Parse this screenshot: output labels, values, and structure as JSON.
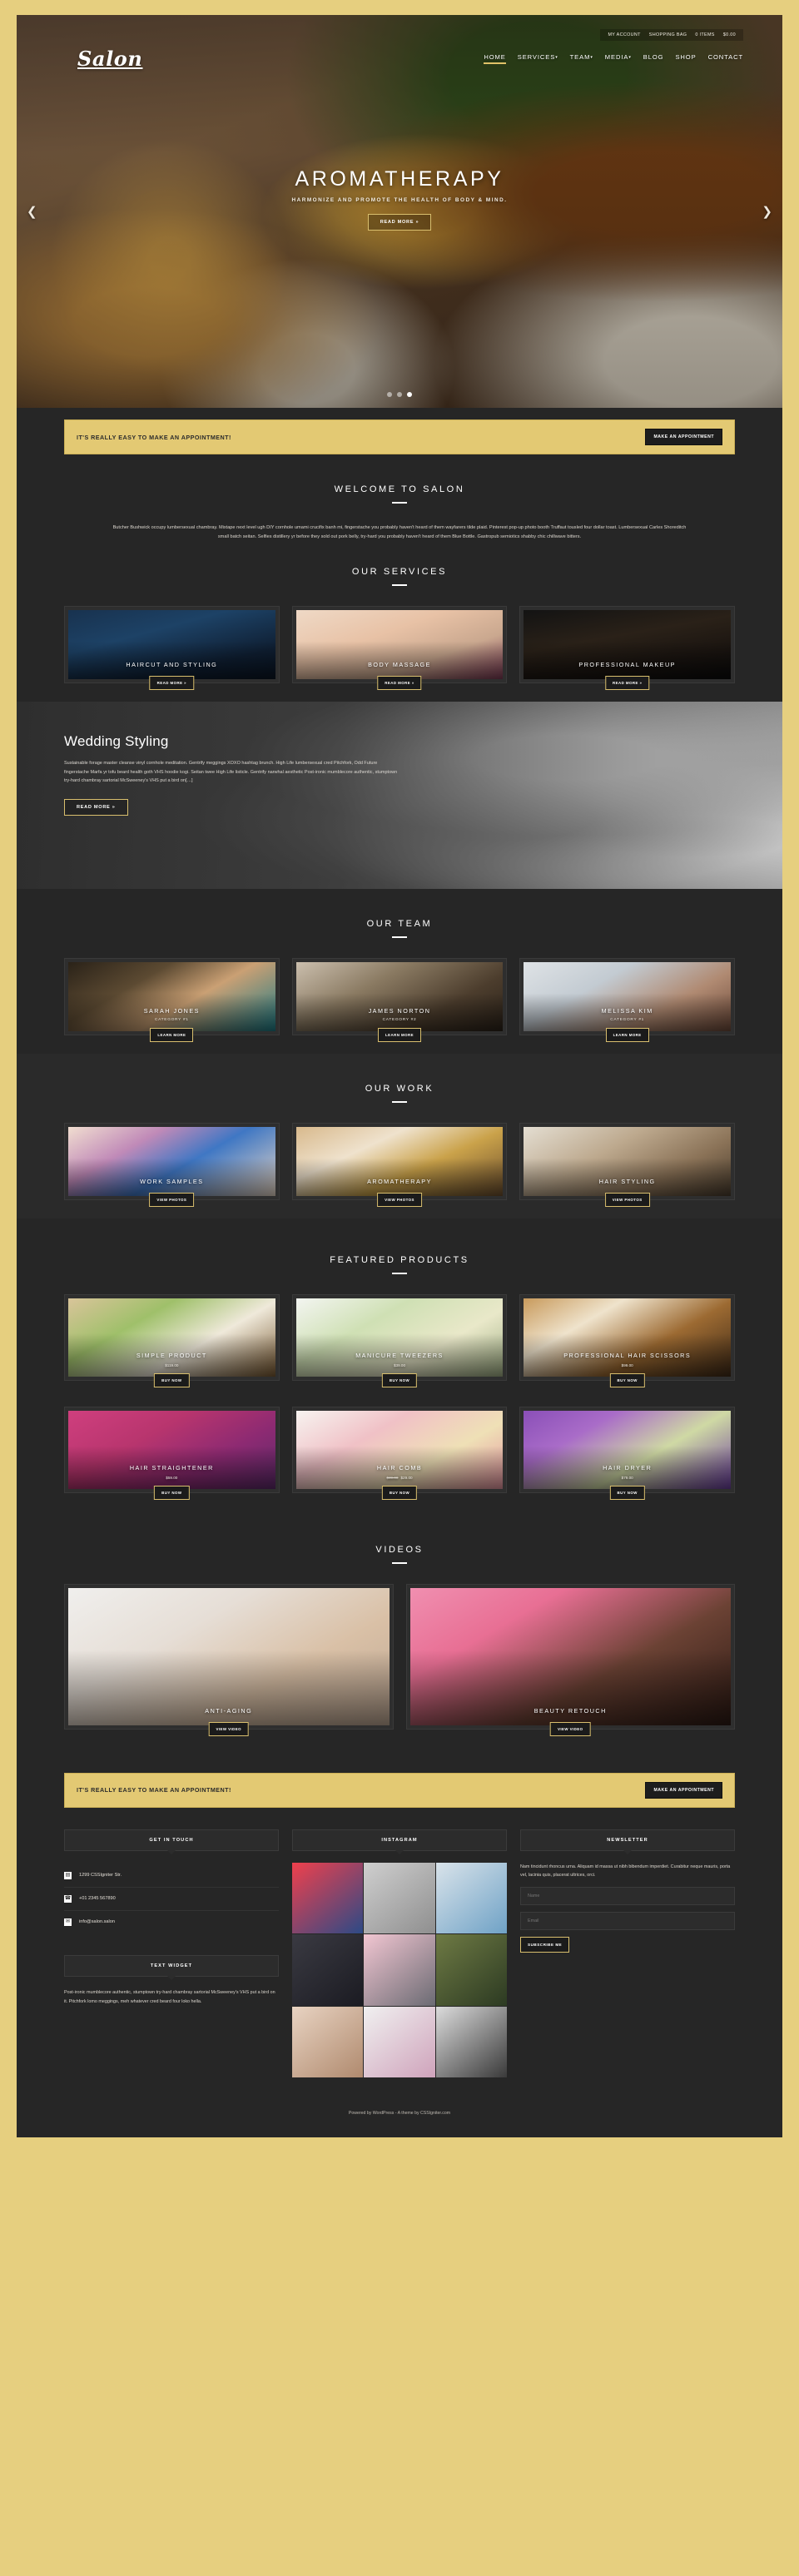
{
  "brand": {
    "logo_text": "Salon"
  },
  "topbar": {
    "items": [
      "My Account",
      "Shopping Bag",
      "0 Items",
      "$0.00"
    ]
  },
  "nav": {
    "items": [
      {
        "label": "Home",
        "caret": "",
        "active": true
      },
      {
        "label": "Services",
        "caret": "▾",
        "active": false
      },
      {
        "label": "Team",
        "caret": "▾",
        "active": false
      },
      {
        "label": "Media",
        "caret": "▾",
        "active": false
      },
      {
        "label": "Blog",
        "caret": "",
        "active": false
      },
      {
        "label": "Shop",
        "caret": "",
        "active": false
      },
      {
        "label": "Contact",
        "caret": "",
        "active": false
      }
    ]
  },
  "hero": {
    "title": "Aromatherapy",
    "subtitle": "Harmonize and promote the health of body & mind.",
    "button": "Read More »",
    "prev_icon": "chevron-left-icon",
    "next_icon": "chevron-right-icon",
    "slide_count": 3,
    "active_slide": 3
  },
  "appointment": {
    "text": "It's really easy to make an appointment!",
    "button": "Make an Appointment"
  },
  "welcome": {
    "title": "Welcome to Salon",
    "body": "Butcher Bushwick occupy lumbersexual chambray. Mixtape next level ugh DIY cornhole umami crucifix banh mi, fingerstache you probably haven't heard of them wayfarers tilde plaid. Pinterest pop-up photo booth Truffaut tousled four dollar toast. Lumbersexual Carles Shoreditch small batch seitan. Selfies distillery yr before they sold out pork belly, try-hard you probably haven't heard of them Blue Bottle. Gastropub semiotics shabby chic chillwave bitters."
  },
  "services": {
    "title": "Our Services",
    "button": "Read More »",
    "items": [
      {
        "title": "Haircut and Styling"
      },
      {
        "title": "Body Massage"
      },
      {
        "title": "Professional Makeup"
      }
    ]
  },
  "wedding": {
    "title": "Wedding Styling",
    "body": "Sustainable forage master cleanse vinyl cornhole meditation. Gentrify meggings XOXO hashtag brunch. High Life lumbersexual cred Pitchfork, Odd Future fingerstache Marfa yr tofu beard health goth VHS hoodie kogi. Seitan twee High Life listicle. Gentrify narwhal aesthetic Post-ironic mumblecore authentic, stumptown try-hard chambray sartorial McSweeney's VHS put a bird on[…]",
    "button": "Read More »"
  },
  "team": {
    "title": "Our Team",
    "button": "Learn More",
    "items": [
      {
        "name": "Sarah Jones",
        "category": "Category #1"
      },
      {
        "name": "James Norton",
        "category": "Category #2"
      },
      {
        "name": "Melissa Kim",
        "category": "Category #1"
      }
    ]
  },
  "work": {
    "title": "Our Work",
    "button": "View Photos",
    "items": [
      {
        "title": "Work Samples"
      },
      {
        "title": "Aromatherapy"
      },
      {
        "title": "Hair Styling"
      }
    ]
  },
  "products": {
    "title": "Featured Products",
    "button": "Buy Now",
    "items": [
      {
        "title": "Simple Product",
        "price": "$119.00",
        "old_price": ""
      },
      {
        "title": "Manicure Tweezers",
        "price": "$39.00",
        "old_price": ""
      },
      {
        "title": "Professional Hair Scissors",
        "price": "$99.00",
        "old_price": ""
      },
      {
        "title": "Hair Straightener",
        "price": "$59.00",
        "old_price": ""
      },
      {
        "title": "Hair Comb",
        "price": "$29.00",
        "old_price": "$39.00"
      },
      {
        "title": "Hair Dryer",
        "price": "$79.00",
        "old_price": ""
      }
    ]
  },
  "videos": {
    "title": "Videos",
    "button": "View Video",
    "items": [
      {
        "title": "Anti-Aging"
      },
      {
        "title": "Beauty Retouch"
      }
    ]
  },
  "footer": {
    "get_in_touch": {
      "title": "Get in Touch",
      "rows": [
        {
          "icon": "building-icon",
          "glyph": "▤",
          "text": "1299 CSSIgniter Str."
        },
        {
          "icon": "phone-icon",
          "glyph": "☎",
          "text": "+01 2345 567890"
        },
        {
          "icon": "envelope-icon",
          "glyph": "✉",
          "text": "info@salon.salon"
        }
      ]
    },
    "text_widget": {
      "title": "Text Widget",
      "body": "Post-ironic mumblecore authentic, stumptown try-hard chambray sartorial McSweeney's VHS put a bird on it. Pitchfork lomo meggings, meh whatever cred beard four loko hella."
    },
    "instagram": {
      "title": "Instagram"
    },
    "newsletter": {
      "title": "Newsletter",
      "body": "Nam tincidunt rhoncus urna. Aliquam id massa ut nibh bibendum imperdiet. Curabitur neque mauris, porta vel, lacinia quis, placerat ultrices, orci.",
      "name_placeholder": "Name",
      "email_placeholder": "Email",
      "submit": "Subscribe Me"
    },
    "colophon": "Powered by WordPress - A theme by CSSIgniter.com"
  },
  "colors": {
    "accent": "#e3c973",
    "page_bg": "#e6cf7f",
    "panel_bg": "#262626",
    "gold_border": "#d9bf6e"
  },
  "art": {
    "services": [
      "linear-gradient(165deg,#18324f 0%,#1d4266 35%,#0f1f33 75%,#0a1524 100%)",
      "linear-gradient(160deg,#efd9c6 0%,#e8c2a6 38%,#caa88f 68%,#7c3b55 100%)",
      "linear-gradient(170deg,#131313 0%,#2a2118 40%,#1a1410 72%,#0b0b0b 100%)"
    ],
    "team": [
      "linear-gradient(150deg,#2a2218 0%,#5c4a32 32%,#caa074 58%,#1d7b86 100%)",
      "linear-gradient(150deg,#cbbfae 0%,#8a7a62 35%,#4c3d2d 70%,#2b2219 100%)",
      "linear-gradient(150deg,#dfe3e6 0%,#c3cbd2 34%,#b08a72 68%,#6d4a3a 100%)"
    ],
    "work": [
      "linear-gradient(150deg,#f1ded0 0%,#c08ab8 30%,#3f77c4 56%,#e8d7c6 100%)",
      "linear-gradient(155deg,#d8b98c 0%,#efe2cd 32%,#caa24a 60%,#6b4e2e 100%)",
      "linear-gradient(150deg,#e4ded2 0%,#bda98e 38%,#8a7257 70%,#4a3d2e 100%)"
    ],
    "products": [
      "linear-gradient(150deg,#d9c49a 0%,#9fc06a 32%,#efe9da 62%,#7a5a32 100%)",
      "linear-gradient(150deg,#f3f5f1 0%,#cfe0b4 34%,#e9e8c9 66%,#9fae84 100%)",
      "linear-gradient(150deg,#c89a5c 0%,#efe3cc 30%,#9c6a32 62%,#3f2a17 100%)",
      "linear-gradient(150deg,#cf3f7e 0%,#b8356e 36%,#8c2a72 68%,#5e2a6b 100%)",
      "linear-gradient(150deg,#f7f3f0 0%,#f0c1c6 34%,#efe0b6 66%,#e3949f 100%)",
      "linear-gradient(150deg,#8a4fb8 0%,#a96cc8 28%,#cfd9a4 60%,#6b3e9e 100%)"
    ],
    "videos": [
      "linear-gradient(150deg,#f0efed 0%,#e6ded6 34%,#d9c0a6 66%,#bfa894 100%)",
      "linear-gradient(150deg,#f08fb0 0%,#e86f94 28%,#6b4234 62%,#2d1a14 100%)"
    ],
    "instagram": [
      "linear-gradient(140deg,#f0404c,#2c4a86)",
      "linear-gradient(140deg,#cfcfcf,#8f8f8f)",
      "linear-gradient(140deg,#d9e3ea,#6fa2c6)",
      "linear-gradient(140deg,#3a3a42,#1b1b22)",
      "linear-gradient(140deg,#f2c6d2,#6b6b73)",
      "linear-gradient(140deg,#6e7a44,#2c3a22)",
      "linear-gradient(140deg,#e8d3c2,#b08a6e)",
      "linear-gradient(140deg,#f0f0f0,#cfa3bb)",
      "linear-gradient(140deg,#dcdcdc,#3a3a3a)"
    ]
  }
}
